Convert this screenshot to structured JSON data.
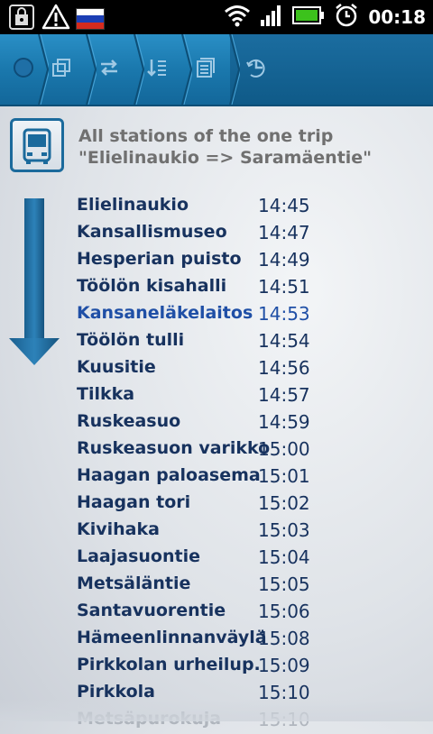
{
  "status_bar": {
    "time": "00:18",
    "icons": [
      "shopping-bag-icon",
      "warning-icon",
      "russian-flag-icon",
      "wifi-icon",
      "signal-icon",
      "battery-icon",
      "alarm-icon"
    ]
  },
  "toolbar": {
    "buttons": [
      "home-icon",
      "copy-icon",
      "swap-icon",
      "sort-icon",
      "list-icon",
      "history-icon"
    ],
    "accent_color": "#1a78ad"
  },
  "header": {
    "title_line1": "All stations of the one trip",
    "title_line2": "\"Elielinaukio => Saramäentie\"",
    "icon": "bus-icon"
  },
  "stops": [
    {
      "name": "Elielinaukio",
      "time": "14:45"
    },
    {
      "name": "Kansallismuseo",
      "time": "14:47"
    },
    {
      "name": "Hesperian puisto",
      "time": "14:49"
    },
    {
      "name": "Töölön kisahalli",
      "time": "14:51"
    },
    {
      "name": "Kansaneläkelaitos",
      "time": "14:53",
      "current": true
    },
    {
      "name": "Töölön tulli",
      "time": "14:54"
    },
    {
      "name": "Kuusitie",
      "time": "14:56"
    },
    {
      "name": "Tilkka",
      "time": "14:57"
    },
    {
      "name": "Ruskeasuo",
      "time": "14:59"
    },
    {
      "name": "Ruskeasuon varikko",
      "time": "15:00"
    },
    {
      "name": "Haagan paloasema",
      "time": "15:01"
    },
    {
      "name": "Haagan tori",
      "time": "15:02"
    },
    {
      "name": "Kivihaka",
      "time": "15:03"
    },
    {
      "name": "Laajasuontie",
      "time": "15:04"
    },
    {
      "name": "Metsäläntie",
      "time": "15:05"
    },
    {
      "name": "Santavuorentie",
      "time": "15:06"
    },
    {
      "name": "Hämeenlinnanväylä",
      "time": "15:08"
    },
    {
      "name": "Pirkkolan urheilup.",
      "time": "15:09"
    },
    {
      "name": "Pirkkola",
      "time": "15:10"
    },
    {
      "name": "Metsäpurokuja",
      "time": "15:10",
      "faded": true
    }
  ]
}
